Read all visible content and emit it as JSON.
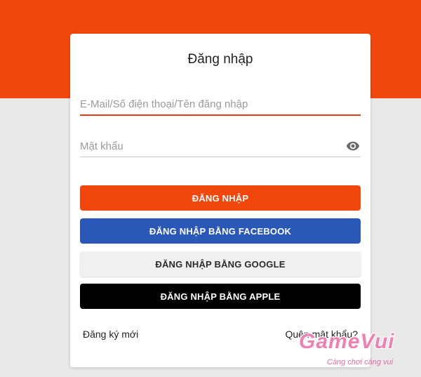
{
  "login": {
    "title": "Đăng nhập",
    "email_placeholder": "E-Mail/Số điện thoại/Tên đăng nhập",
    "password_placeholder": "Mật khẩu",
    "show_password_icon": "eye-icon",
    "buttons": {
      "login": "ĐĂNG NHẬP",
      "facebook": "ĐĂNG NHẬP BẰNG FACEBOOK",
      "google": "ĐĂNG NHẬP BẰNG GOOGLE",
      "apple": "ĐĂNG NHẬP BẰNG APPLE"
    },
    "register_link": "Đăng ký mới",
    "forgot_link": "Quên mật khẩu?"
  },
  "watermark": {
    "logo_text": "GameVui",
    "tagline": "Càng chơi càng vui"
  },
  "colors": {
    "brand": "#f2470c",
    "facebook": "#2a58b8",
    "google_bg": "#f0f0f0",
    "apple": "#000000",
    "page_bg": "#e9e9e9"
  }
}
